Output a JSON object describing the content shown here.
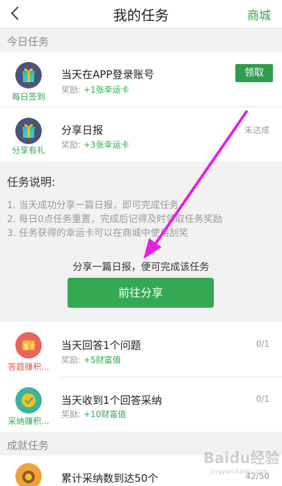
{
  "header": {
    "title": "我的任务",
    "mall_label": "商城"
  },
  "sections": {
    "daily": "今日任务",
    "achievement": "成就任务"
  },
  "daily_tasks": [
    {
      "caption": "每日签到",
      "name": "当天在APP登录账号",
      "reward_prefix": "奖励: ",
      "reward_value": "+1张幸运卡",
      "action": "领取"
    },
    {
      "caption": "分享有礼",
      "name": "分享日报",
      "reward_prefix": "奖励: ",
      "reward_value": "+3张幸运卡",
      "status": "未达成"
    }
  ],
  "share_panel": {
    "heading": "任务说明:",
    "lines": [
      "1. 当天成功分享一篇日报，即可完成任务",
      "2. 每日0点任务重置，完成后记得及时领取任务奖励",
      "3. 任务获得的幸运卡可以在商城中使用刮奖"
    ],
    "prompt": "分享一篇日报，便可完成该任务",
    "button": "前往分享"
  },
  "more_tasks": [
    {
      "caption": "答题赚积...",
      "name": "当天回答1个问题",
      "reward_prefix": "奖励: ",
      "reward_value": "+5财富值",
      "status": "0/1"
    },
    {
      "caption": "采纳赚积...",
      "name": "当天收到1个回答采纳",
      "reward_prefix": "奖励: ",
      "reward_value": "+10财富值",
      "status": "0/1"
    }
  ],
  "achievement_tasks": [
    {
      "name": "累计采纳数到达50个",
      "status": "42/50"
    }
  ],
  "watermark": {
    "text": "Baidu经验",
    "sub": "jingyan.baidu.com"
  },
  "colors": {
    "accent_green": "#2dab4f",
    "button_green": "#34a853",
    "annotation_magenta": "#e61ee6"
  }
}
